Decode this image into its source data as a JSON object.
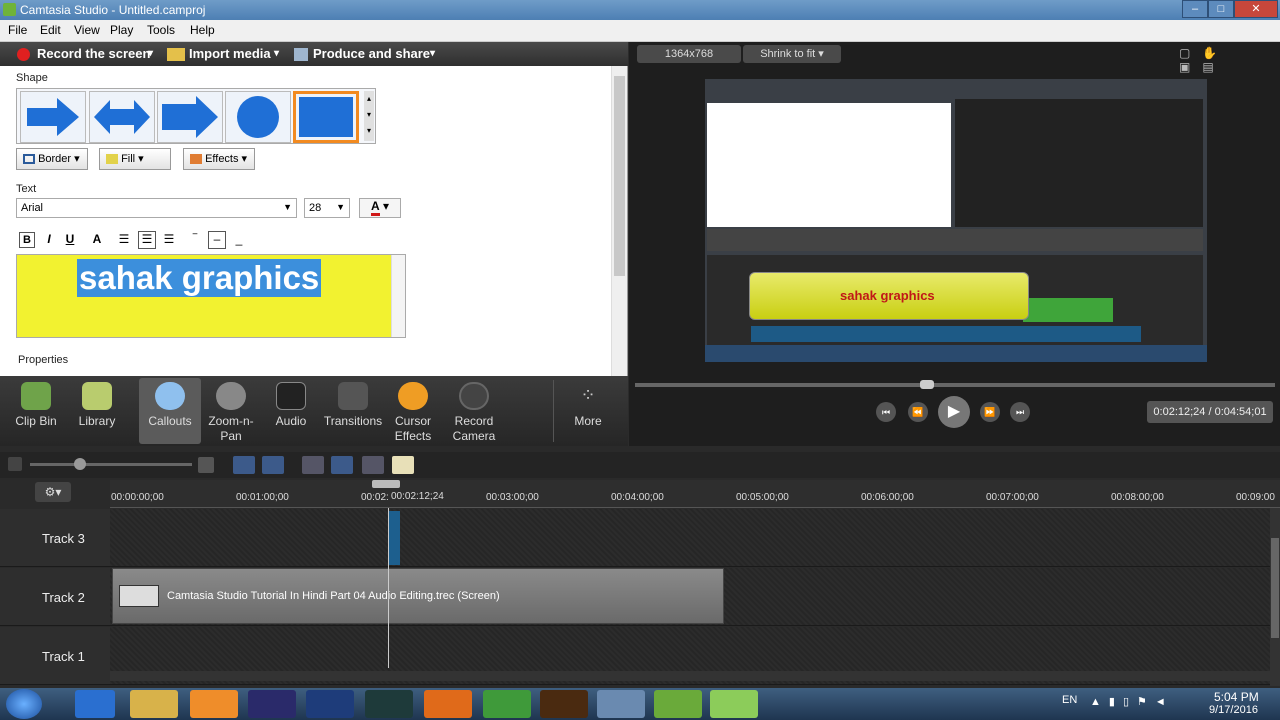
{
  "window": {
    "title": "Camtasia Studio - Untitled.camproj",
    "buttons": [
      "–",
      "□",
      "✕"
    ]
  },
  "menu": [
    "File",
    "Edit",
    "View",
    "Play",
    "Tools",
    "Help"
  ],
  "toolbar": {
    "record": "Record the screen",
    "import": "Import media",
    "produce": "Produce and share"
  },
  "shape": {
    "label": "Shape",
    "border": "Border",
    "fill": "Fill",
    "effects": "Effects"
  },
  "text": {
    "label": "Text",
    "font": "Arial",
    "size": "28",
    "content": "sahak graphics"
  },
  "properties": {
    "label": "Properties"
  },
  "tools": [
    "Clip Bin",
    "Library",
    "Callouts",
    "Zoom-n-\nPan",
    "Audio",
    "Transitions",
    "Cursor\nEffects",
    "Record\nCamera",
    "More"
  ],
  "preview": {
    "resolution": "1364x768",
    "fit": "Shrink to fit",
    "callout_text": "sahak graphics",
    "time": "0:02:12;24 / 0:04:54;01"
  },
  "timeline": {
    "ticks": [
      "00:00:00;00",
      "00:01:00;00",
      "00:02:",
      "00:02:12;24",
      "00:03:00;00",
      "00:04:00;00",
      "00:05:00;00",
      "00:06:00;00",
      "00:07:00;00",
      "00:08:00;00",
      "00:09:00"
    ],
    "tracks": [
      "Track 3",
      "Track 2",
      "Track 1"
    ],
    "clip": "Camtasia Studio Tutorial In Hindi Part 04 Audio Editing.trec (Screen)"
  },
  "taskbar": {
    "lang": "EN",
    "time": "5:04 PM",
    "date": "9/17/2016"
  }
}
